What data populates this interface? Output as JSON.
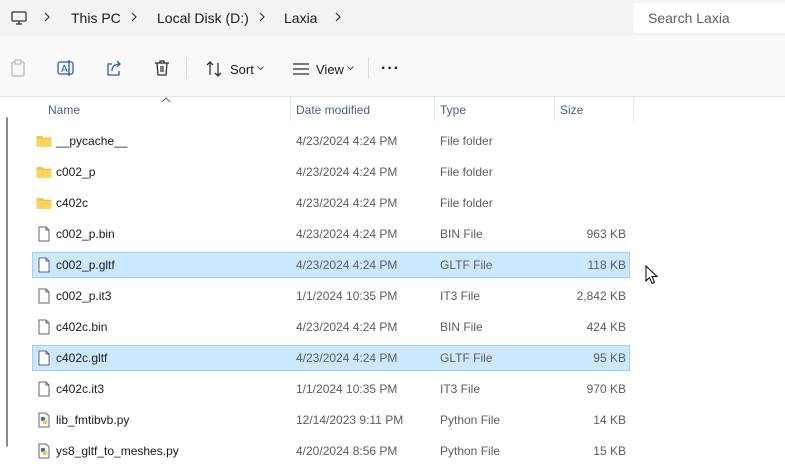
{
  "breadcrumb": {
    "items": [
      "This PC",
      "Local Disk (D:)",
      "Laxia"
    ]
  },
  "search": {
    "placeholder": "Search Laxia"
  },
  "toolbar": {
    "sort_label": "Sort",
    "view_label": "View",
    "more_label": "···"
  },
  "columns": {
    "name": "Name",
    "date": "Date modified",
    "type": "Type",
    "size": "Size"
  },
  "files": [
    {
      "name": "__pycache__",
      "date": "4/23/2024 4:24 PM",
      "type": "File folder",
      "size": "",
      "icon": "folder-icon",
      "selected": false
    },
    {
      "name": "c002_p",
      "date": "4/23/2024 4:24 PM",
      "type": "File folder",
      "size": "",
      "icon": "folder-icon",
      "selected": false
    },
    {
      "name": "c402c",
      "date": "4/23/2024 4:24 PM",
      "type": "File folder",
      "size": "",
      "icon": "folder-icon",
      "selected": false
    },
    {
      "name": "c002_p.bin",
      "date": "4/23/2024 4:24 PM",
      "type": "BIN File",
      "size": "963 KB",
      "icon": "file-icon",
      "selected": false
    },
    {
      "name": "c002_p.gltf",
      "date": "4/23/2024 4:24 PM",
      "type": "GLTF File",
      "size": "118 KB",
      "icon": "file-icon",
      "selected": true
    },
    {
      "name": "c002_p.it3",
      "date": "1/1/2024 10:35 PM",
      "type": "IT3 File",
      "size": "2,842 KB",
      "icon": "file-icon",
      "selected": false
    },
    {
      "name": "c402c.bin",
      "date": "4/23/2024 4:24 PM",
      "type": "BIN File",
      "size": "424 KB",
      "icon": "file-icon",
      "selected": false
    },
    {
      "name": "c402c.gltf",
      "date": "4/23/2024 4:24 PM",
      "type": "GLTF File",
      "size": "95 KB",
      "icon": "file-icon",
      "selected": true
    },
    {
      "name": "c402c.it3",
      "date": "1/1/2024 10:35 PM",
      "type": "IT3 File",
      "size": "970 KB",
      "icon": "file-icon",
      "selected": false
    },
    {
      "name": "lib_fmtibvb.py",
      "date": "12/14/2023 9:11 PM",
      "type": "Python File",
      "size": "14 KB",
      "icon": "python-file-icon",
      "selected": false
    },
    {
      "name": "ys8_gltf_to_meshes.py",
      "date": "4/20/2024 8:56 PM",
      "type": "Python File",
      "size": "15 KB",
      "icon": "python-file-icon",
      "selected": false
    }
  ],
  "colors": {
    "selection": "#cce8ff",
    "selection_border": "#99d1ff",
    "folder": "#f8c73e",
    "header_text": "#4a5f80"
  }
}
